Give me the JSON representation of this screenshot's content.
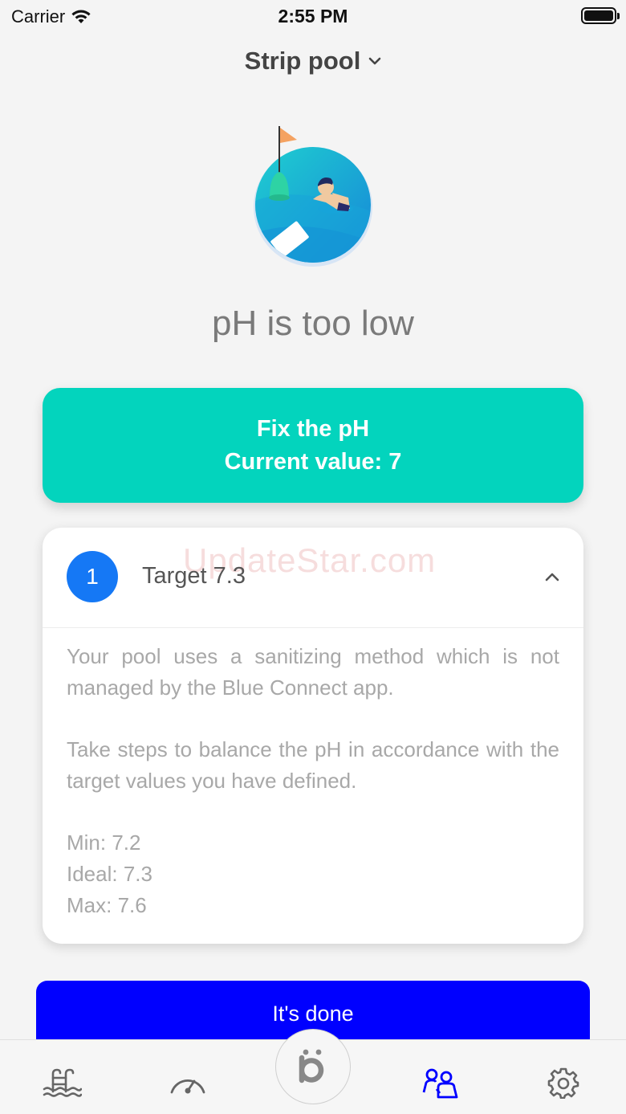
{
  "status_bar": {
    "carrier": "Carrier",
    "time": "2:55 PM"
  },
  "header": {
    "pool_name": "Strip pool"
  },
  "alert": {
    "headline": "pH is too low"
  },
  "fix_button": {
    "line1": "Fix the pH",
    "line2": "Current value: 7"
  },
  "step": {
    "number": "1",
    "title": "Target 7.3",
    "watermark": "UpdateStar.com",
    "paragraph1": "Your pool uses a sanitizing method which is not managed by the Blue Connect app.",
    "paragraph2": "Take steps to balance the pH in accordance with the target values you have defined.",
    "min": "Min: 7.2",
    "ideal": "Ideal: 7.3",
    "max": "Max: 7.6"
  },
  "done_button": {
    "label": "It's done"
  },
  "tab_bar": {
    "tabs": [
      {
        "icon": "pool-ladder-icon",
        "active": false
      },
      {
        "icon": "gauge-icon",
        "active": false
      },
      {
        "icon": "blue-logo-icon",
        "active": false
      },
      {
        "icon": "guidance-people-icon",
        "active": true
      },
      {
        "icon": "gear-icon",
        "active": false
      }
    ],
    "active_color": "#0000ff",
    "inactive_color": "#666666"
  },
  "colors": {
    "accent_teal": "#03d4bd",
    "step_blue": "#1578f5",
    "primary_blue": "#0000ff"
  }
}
